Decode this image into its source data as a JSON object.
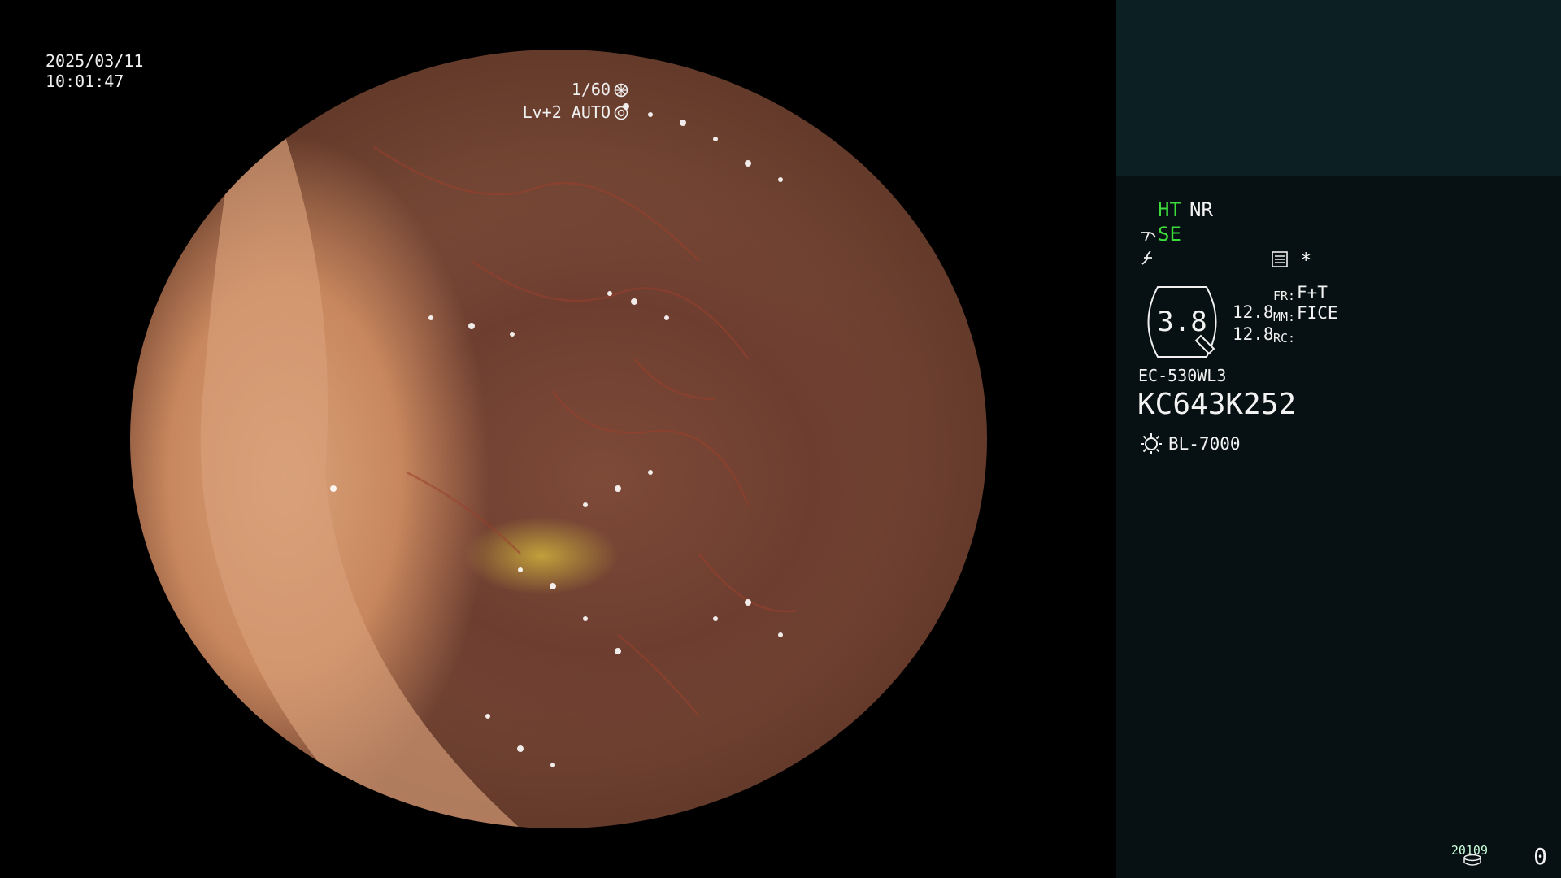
{
  "osd": {
    "date": "2025/03/11",
    "time": "10:01:47",
    "shutter": "1/60",
    "level": "Lv+2 AUTO"
  },
  "panel": {
    "ht": "HT",
    "nr": "NR",
    "se": "SE",
    "asterisk": "*",
    "zoom_value": "3.8",
    "val_a": "12.8",
    "val_b": "12.8",
    "fr_label": "FR:",
    "fr_value": "F+T",
    "mm_label": "MM:",
    "mm_value": "FICE",
    "rc_label": "RC:",
    "scope_model": "EC-530WL3",
    "scope_serial": "KC643K252",
    "light_source": "BL-7000",
    "counter_label": "20109",
    "counter_value": "0"
  },
  "colors": {
    "panel_bg": "#071012",
    "panel_top_bg": "#0c1f22",
    "active_mode": "#3ddc3d",
    "text": "#f2f2f2"
  },
  "icons": [
    "shutter-icon",
    "aperture-icon",
    "scope-tip-icon",
    "lightning-icon",
    "menu-icon",
    "zoom-badge-icon",
    "light-source-icon",
    "storage-icon"
  ]
}
